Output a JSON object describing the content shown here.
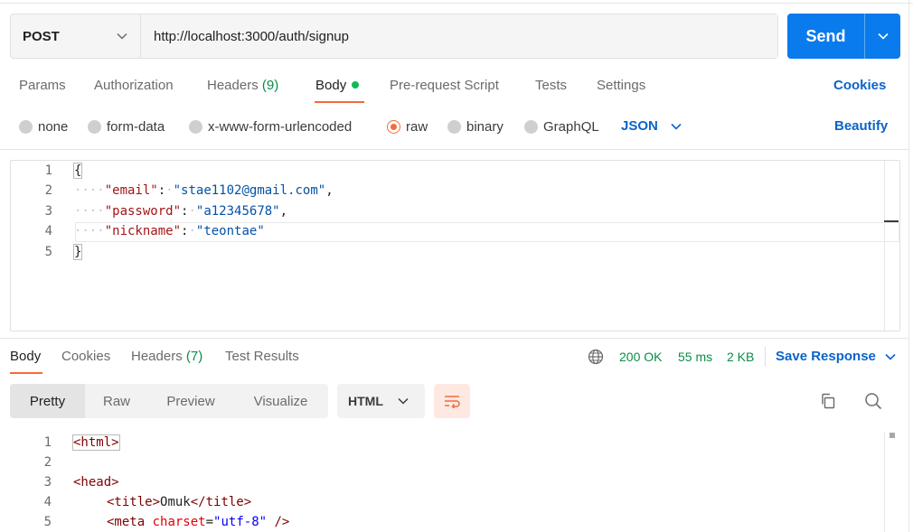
{
  "request": {
    "method": "POST",
    "url": "http://localhost:3000/auth/signup",
    "send_label": "Send"
  },
  "request_tabs": [
    {
      "label": "Params"
    },
    {
      "label": "Authorization"
    },
    {
      "label": "Headers",
      "count": "(9)"
    },
    {
      "label": "Body",
      "active": true
    },
    {
      "label": "Pre-request Script"
    },
    {
      "label": "Tests"
    },
    {
      "label": "Settings"
    }
  ],
  "cookies_link": "Cookies",
  "body_types": [
    {
      "label": "none"
    },
    {
      "label": "form-data"
    },
    {
      "label": "x-www-form-urlencoded"
    },
    {
      "label": "raw",
      "selected": true
    },
    {
      "label": "binary"
    },
    {
      "label": "GraphQL"
    }
  ],
  "raw_format": "JSON",
  "beautify_label": "Beautify",
  "request_body": {
    "line_numbers": [
      "1",
      "2",
      "3",
      "4",
      "5"
    ],
    "open_brace": "{",
    "close_brace": "}",
    "fields": [
      {
        "key": "\"email\"",
        "value": "\"stae1102@gmail.com\"",
        "comma": ","
      },
      {
        "key": "\"password\"",
        "value": "\"a12345678\"",
        "comma": ","
      },
      {
        "key": "\"nickname\"",
        "value": "\"teontae\"",
        "comma": ""
      }
    ]
  },
  "response_tabs": [
    {
      "label": "Body",
      "active": true
    },
    {
      "label": "Cookies"
    },
    {
      "label": "Headers",
      "count": "(7)"
    },
    {
      "label": "Test Results"
    }
  ],
  "response_status": {
    "code": "200 OK",
    "time": "55 ms",
    "size": "2 KB"
  },
  "save_response_label": "Save Response",
  "view_modes": [
    "Pretty",
    "Raw",
    "Preview",
    "Visualize"
  ],
  "response_format": "HTML",
  "response_body": {
    "line_numbers": [
      "1",
      "2",
      "3",
      "4",
      "5"
    ],
    "lines": {
      "l1_open": "<html>",
      "l3": "<head>",
      "l4_open": "<title>",
      "l4_text": "Omuk",
      "l4_close": "</title>",
      "l5_tag": "<meta",
      "l5_attr": "charset",
      "l5_eq": "=",
      "l5_val": "\"utf-8\"",
      "l5_end": " />"
    }
  },
  "colors": {
    "accent_orange": "#f26b3a",
    "send_blue": "#097bed",
    "link_blue": "#0b64c8",
    "status_green": "#0a8c4a"
  }
}
